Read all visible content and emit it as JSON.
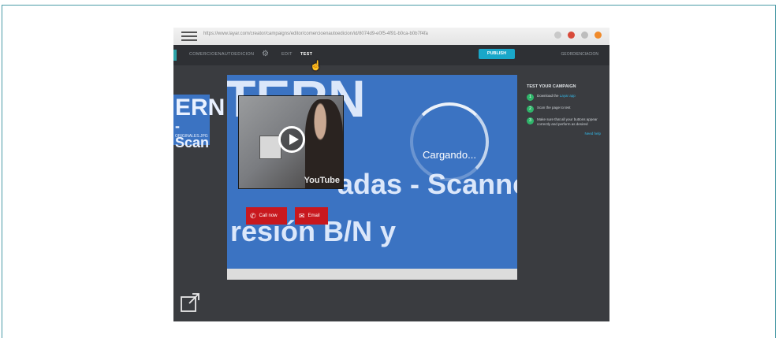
{
  "browser": {
    "url": "https://www.layar.com/creator/campaigns/editor/comercioenautoedicion/id/8074d9-e0f5-4f91-b0ca-b0b7f4fa"
  },
  "app": {
    "campaign_name": "COMERCIOENAUTOEDICION",
    "tabs": [
      {
        "label": "EDIT",
        "active": false
      },
      {
        "label": "TEST",
        "active": true
      }
    ],
    "publish_label": "PUBLISH",
    "user_label": "GEORDIENCIACION"
  },
  "stage": {
    "banner_word_1": "TERN",
    "banner_word_2": "adas - Scanne",
    "banner_word_3": "resión B/N y",
    "left_panel_1": "ERN",
    "left_panel_2": "- Scan",
    "left_panel_3": "ORIGINALES.JPG",
    "youtube_logo": "YouTube",
    "loading_text": "Cargando...",
    "call_button": "Call now",
    "email_button": "Email"
  },
  "test_panel": {
    "title": "TEST YOUR CAMPAIGN",
    "steps": [
      {
        "num": "1",
        "text": "Download the",
        "link": "Layar app"
      },
      {
        "num": "2",
        "text": "Scan the page to test",
        "link": ""
      },
      {
        "num": "3",
        "text": "Make sure that all your buttons appear correctly and perform as desired",
        "link": ""
      }
    ],
    "more_link": "Need help"
  },
  "colors": {
    "frame_border": "#4a9aa6",
    "stage_blue": "#3b73c2",
    "publish": "#19a7c9",
    "action_red": "#c8181e",
    "step_green": "#2fb56a"
  },
  "icons": [
    "hamburger-icon",
    "gear-icon",
    "play-icon",
    "phone-icon",
    "email-icon",
    "popout-icon",
    "cursor-icon"
  ]
}
